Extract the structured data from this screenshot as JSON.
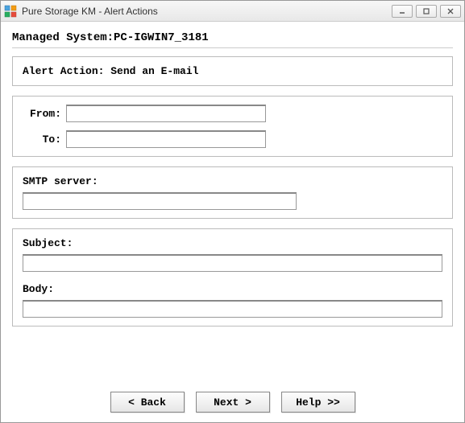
{
  "window": {
    "title": "Pure Storage KM - Alert Actions"
  },
  "heading": {
    "label": "Managed System:",
    "value": "PC-IGWIN7_3181"
  },
  "action_panel": {
    "title": "Alert Action: Send an E-mail"
  },
  "email": {
    "from_label": "From:",
    "from_value": "",
    "to_label": "To:",
    "to_value": ""
  },
  "smtp": {
    "label": "SMTP server:",
    "value": ""
  },
  "message": {
    "subject_label": "Subject:",
    "subject_value": "",
    "body_label": "Body:",
    "body_value": ""
  },
  "buttons": {
    "back": "< Back",
    "next": "Next >",
    "help": "Help >>"
  }
}
